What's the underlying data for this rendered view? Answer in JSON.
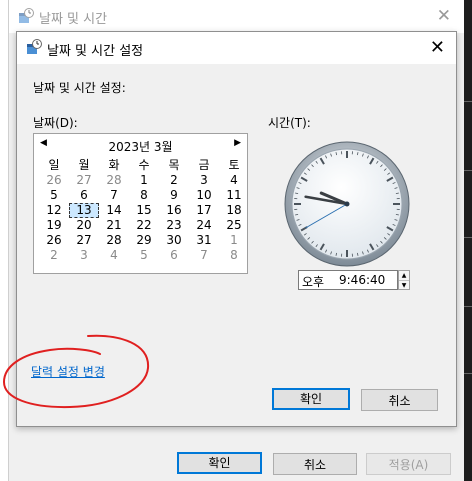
{
  "background_window": {
    "title": "날짜 및 시간",
    "buttons": {
      "ok": "확인",
      "cancel": "취소",
      "apply": "적용(A)"
    }
  },
  "dialog": {
    "title": "날짜 및 시간 설정",
    "heading": "날짜 및 시간 설정:",
    "date_label": "날짜(D):",
    "time_label": "시간(T):",
    "calendar": {
      "month_label": "2023년 3월",
      "weekdays": [
        "일",
        "월",
        "화",
        "수",
        "목",
        "금",
        "토"
      ],
      "weeks": [
        [
          "26",
          "27",
          "28",
          "1",
          "2",
          "3",
          "4"
        ],
        [
          "5",
          "6",
          "7",
          "8",
          "9",
          "10",
          "11"
        ],
        [
          "12",
          "13",
          "14",
          "15",
          "16",
          "17",
          "18"
        ],
        [
          "19",
          "20",
          "21",
          "22",
          "23",
          "24",
          "25"
        ],
        [
          "26",
          "27",
          "28",
          "29",
          "30",
          "31",
          "1"
        ],
        [
          "2",
          "3",
          "4",
          "5",
          "6",
          "7",
          "8"
        ]
      ],
      "selected_day": "13"
    },
    "time": {
      "ampm": "오후",
      "value": "9:46:40"
    },
    "clock": {
      "hour": 9,
      "minute": 46,
      "second": 40
    },
    "calendar_settings_link": "달력 설정 변경",
    "buttons": {
      "ok": "확인",
      "cancel": "취소"
    }
  },
  "colors": {
    "accent": "#0078d7",
    "link": "#0066cc",
    "annotation": "#e02020"
  }
}
